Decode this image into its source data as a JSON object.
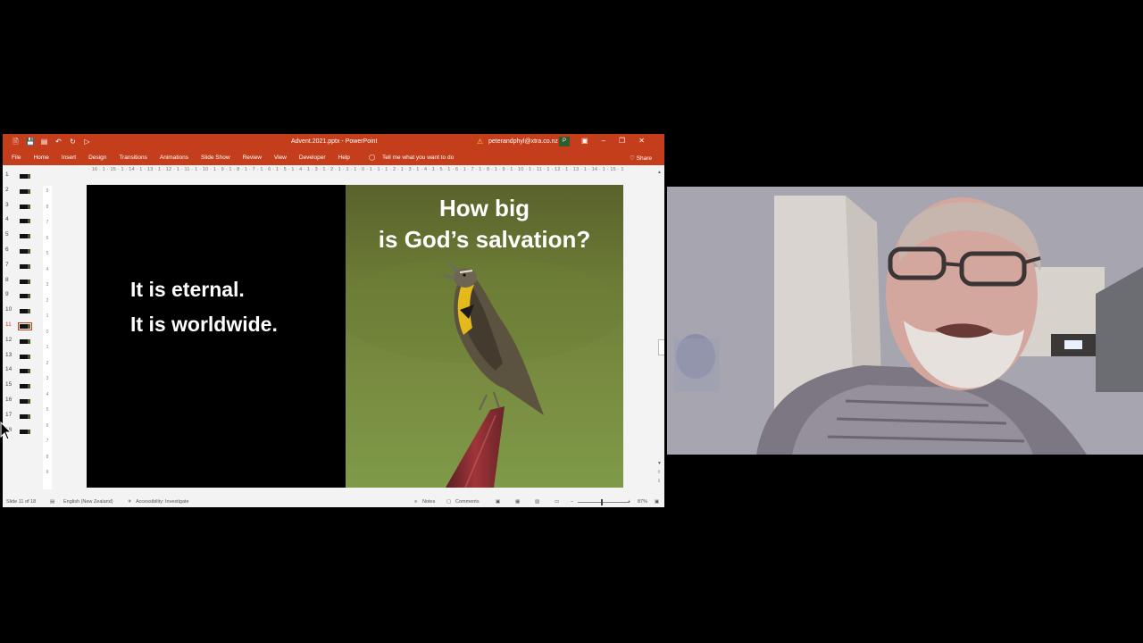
{
  "window": {
    "document_title": "Advent.2021.pptx  -  PowerPoint",
    "account": "peterandphyl@xtra.co.nz",
    "qat_icons": [
      "new-icon",
      "save-icon",
      "open-icon",
      "undo-icon",
      "redo-icon",
      "present-icon"
    ],
    "window_controls": [
      "ribbon-display-icon",
      "minimize-icon",
      "restore-icon",
      "close-icon"
    ]
  },
  "ribbon": {
    "tabs": [
      "File",
      "Home",
      "Insert",
      "Design",
      "Transitions",
      "Animations",
      "Slide Show",
      "Review",
      "View",
      "Developer",
      "Help"
    ],
    "tell_me": "Tell me what you want to do",
    "share": "Share"
  },
  "ruler": {
    "horizontal": "· 16 · 1 · 15 · 1 · 14 · 1 · 13 · 1 · 12 · 1 · 11 · 1 · 10 · 1 · 9 · 1 · 8 · 1 · 7 · 1 · 6 · 1 · 5 · 1 · 4 · 1 · 3 · 1 · 2 · 1 · 1 · 1 · 0 · 1 · 1 · 1 · 2 · 1 · 3 · 1 · 4 · 1 · 5 · 1 · 6 · 1 · 7 · 1 · 8 · 1 · 9 · 1 · 10 · 1 · 11 · 1 · 12 · 1 · 13 · 1 · 14 · 1 · 15 · 1 · 16 ·",
    "vertical": [
      "9",
      "8",
      "7",
      "6",
      "5",
      "4",
      "3",
      "2",
      "1",
      "0",
      "1",
      "2",
      "3",
      "4",
      "5",
      "6",
      "7",
      "8",
      "9"
    ]
  },
  "thumbnails": [
    {
      "n": "1"
    },
    {
      "n": "2"
    },
    {
      "n": "3"
    },
    {
      "n": "4"
    },
    {
      "n": "5"
    },
    {
      "n": "6"
    },
    {
      "n": "7"
    },
    {
      "n": "8"
    },
    {
      "n": "9"
    },
    {
      "n": "10"
    },
    {
      "n": "11",
      "active": true
    },
    {
      "n": "12"
    },
    {
      "n": "13"
    },
    {
      "n": "14"
    },
    {
      "n": "15"
    },
    {
      "n": "16"
    },
    {
      "n": "17"
    },
    {
      "n": "18"
    }
  ],
  "slide": {
    "left_line1": "It is eternal.",
    "left_line2": "It is worldwide.",
    "heading_line1": "How big",
    "heading_line2": "is God’s salvation?"
  },
  "status": {
    "slide_of": "Slide 11 of 18",
    "language": "English (New Zealand)",
    "accessibility": "Accessibility: Investigate",
    "notes": "Notes",
    "comments": "Comments",
    "zoom_minus": "−",
    "zoom_plus": "+",
    "zoom": "87%"
  },
  "colors": {
    "accent": "#c43e1c",
    "slide_bg": "#000000"
  }
}
